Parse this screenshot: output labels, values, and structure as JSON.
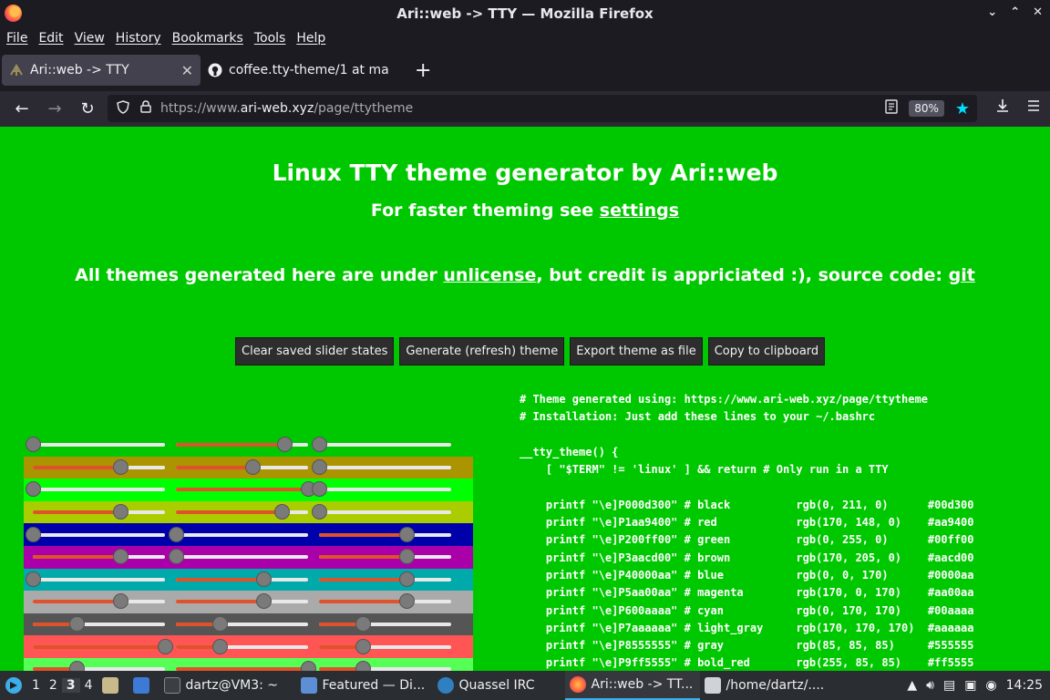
{
  "window": {
    "title": "Ari::web -> TTY — Mozilla Firefox"
  },
  "menu": [
    "File",
    "Edit",
    "View",
    "History",
    "Bookmarks",
    "Tools",
    "Help"
  ],
  "tabs": [
    {
      "label": "Ari::web -> TTY",
      "active": true
    },
    {
      "label": "coffee.tty-theme/1 at ma",
      "active": false
    }
  ],
  "navbar": {
    "url_prefix": "https://www.",
    "url_domain": "ari-web.xyz",
    "url_path": "/page/ttytheme",
    "zoom": "80%"
  },
  "page": {
    "title": "Linux TTY theme generator by Ari::web",
    "subtitle_prefix": "For faster theming see ",
    "subtitle_link": "settings",
    "license_prefix": "All themes generated here are under ",
    "license_link": "unlicense",
    "license_middle": ", but credit is appriciated :), source code: ",
    "license_git": "git",
    "buttons": {
      "clear": "Clear saved slider states",
      "generate": "Generate (refresh) theme",
      "export": "Export theme as file",
      "copy": "Copy to clipboard"
    },
    "slider_rows": [
      {
        "bg": "#00c800",
        "values": [
          0,
          0.82,
          0
        ]
      },
      {
        "bg": "#aa9400",
        "values": [
          0.66,
          0.58,
          0
        ]
      },
      {
        "bg": "#00ff00",
        "values": [
          0,
          1.0,
          0
        ]
      },
      {
        "bg": "#aacd00",
        "values": [
          0.66,
          0.8,
          0
        ]
      },
      {
        "bg": "#0000aa",
        "values": [
          0,
          0,
          0.66
        ]
      },
      {
        "bg": "#aa00aa",
        "values": [
          0.66,
          0,
          0.66
        ]
      },
      {
        "bg": "#00aaaa",
        "values": [
          0,
          0.66,
          0.66
        ]
      },
      {
        "bg": "#aaaaaa",
        "values": [
          0.66,
          0.66,
          0.66
        ]
      },
      {
        "bg": "#555555",
        "values": [
          0.33,
          0.33,
          0.33
        ]
      },
      {
        "bg": "#ff5555",
        "values": [
          1.0,
          0.33,
          0.33
        ]
      },
      {
        "bg": "#55ff55",
        "values": [
          0.33,
          1.0,
          0.33
        ]
      }
    ],
    "code_lines": [
      "# Theme generated using: https://www.ari-web.xyz/page/ttytheme",
      "# Installation: Just add these lines to your ~/.bashrc",
      "",
      "__tty_theme() {",
      "    [ \"$TERM\" != 'linux' ] && return # Only run in a TTY",
      "",
      "    printf \"\\e]P000d300\" # black          rgb(0, 211, 0)      #00d300",
      "    printf \"\\e]P1aa9400\" # red            rgb(170, 148, 0)    #aa9400",
      "    printf \"\\e]P200ff00\" # green          rgb(0, 255, 0)      #00ff00",
      "    printf \"\\e]P3aacd00\" # brown          rgb(170, 205, 0)    #aacd00",
      "    printf \"\\e]P40000aa\" # blue           rgb(0, 0, 170)      #0000aa",
      "    printf \"\\e]P5aa00aa\" # magenta        rgb(170, 0, 170)    #aa00aa",
      "    printf \"\\e]P600aaaa\" # cyan           rgb(0, 170, 170)    #00aaaa",
      "    printf \"\\e]P7aaaaaa\" # light_gray     rgb(170, 170, 170)  #aaaaaa",
      "    printf \"\\e]P8555555\" # gray           rgb(85, 85, 85)     #555555",
      "    printf \"\\e]P9ff5555\" # bold_red       rgb(255, 85, 85)    #ff5555"
    ]
  },
  "taskbar": {
    "desktops": [
      "1",
      "2",
      "3",
      "4"
    ],
    "windows": [
      {
        "label": "dartz@VM3: ~"
      },
      {
        "label": "Featured — Di..."
      },
      {
        "label": "Quassel IRC"
      },
      {
        "label": "Ari::web -> TT..."
      },
      {
        "label": "/home/dartz/...."
      }
    ],
    "clock": "14:25"
  }
}
